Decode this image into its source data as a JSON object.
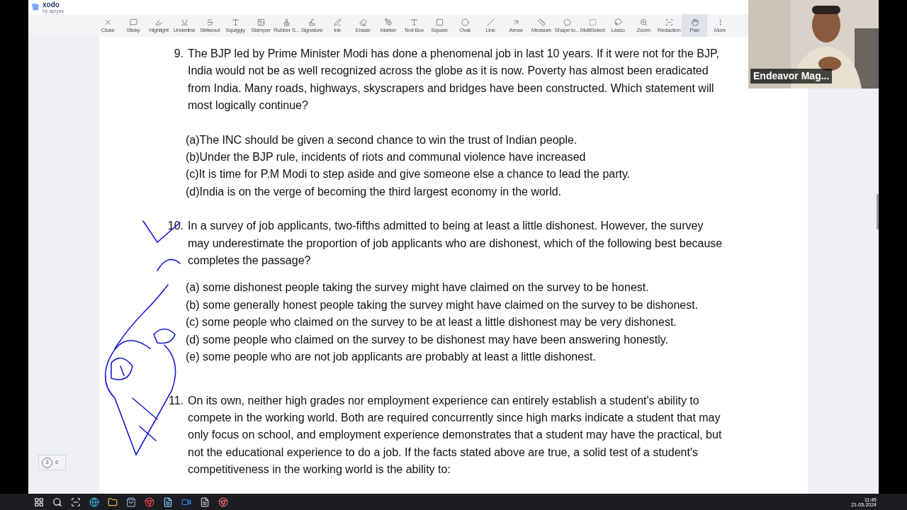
{
  "app": {
    "logo": "xodo",
    "logo_sub": "by apryse"
  },
  "toolbar": [
    {
      "label": "Close",
      "selected": false
    },
    {
      "label": "Sticky",
      "selected": false
    },
    {
      "label": "Highlight",
      "selected": false
    },
    {
      "label": "Underline",
      "selected": false
    },
    {
      "label": "Strikeout",
      "selected": false
    },
    {
      "label": "Squiggly",
      "selected": false
    },
    {
      "label": "Stamper",
      "selected": false
    },
    {
      "label": "Rubber S...",
      "selected": false
    },
    {
      "label": "Signature",
      "selected": false
    },
    {
      "label": "Ink",
      "selected": false
    },
    {
      "label": "Eraser",
      "selected": false
    },
    {
      "label": "Marker",
      "selected": false
    },
    {
      "label": "Text Box",
      "selected": false
    },
    {
      "label": "Square",
      "selected": false
    },
    {
      "label": "Oval",
      "selected": false
    },
    {
      "label": "Line",
      "selected": false
    },
    {
      "label": "Arrow",
      "selected": false
    },
    {
      "label": "Measure",
      "selected": false
    },
    {
      "label": "Shape to...",
      "selected": false
    },
    {
      "label": "MultiSelect",
      "selected": false
    },
    {
      "label": "Lasso",
      "selected": false
    },
    {
      "label": "Zoom",
      "selected": false
    },
    {
      "label": "Redaction",
      "selected": false
    },
    {
      "label": "Pan",
      "selected": true
    },
    {
      "label": "More",
      "selected": false
    }
  ],
  "questions": [
    {
      "number": "9.",
      "lines": [
        "The BJP led by Prime Minister Modi has done a phenomenal job in last 10 years. If it were not for the BJP,",
        "India would not be as well recognized across the globe as it is now. Poverty has almost been eradicated",
        "from India. Many roads, highways, skyscrapers and bridges have been constructed. Which statement will",
        "most logically continue?"
      ],
      "options": [
        "(a)The INC should be given a second chance to win the trust of Indian people.",
        "(b)Under the BJP rule, incidents of riots and communal violence have increased",
        "(c)It is time for P.M Modi to step aside and give someone else a chance to lead the party.",
        "(d)India is on the verge of becoming the third largest economy in the world."
      ]
    },
    {
      "number": "10.",
      "lines": [
        "In a survey of job applicants, two-fifths admitted to being at least a little dishonest. However, the survey",
        "may underestimate the proportion of job applicants who are dishonest, which of the following best because",
        "completes the passage?"
      ],
      "options": [
        "(a) some dishonest people taking the survey might have claimed on the survey to be honest.",
        "(b) some generally honest people taking the survey might have claimed on the survey to be dishonest.",
        "(c) some people who claimed on the survey to be at least a little dishonest may be very dishonest.",
        "(d) some people who claimed on the survey to be dishonest may have been answering honestly.",
        "(e) some people who are not job applicants are probably at least a little dishonest."
      ]
    },
    {
      "number": "11.",
      "lines": [
        "On its own, neither high grades nor employment experience can entirely establish a student's ability to",
        "compete in the working world. Both are required concurrently since high marks indicate a student that may",
        "only focus on school, and employment experience demonstrates that a student may have the practical, but",
        "not the educational experience to do a job. If the facts stated above are true, a solid test of a student's",
        "competitiveness in the working world is the ability to:"
      ]
    }
  ],
  "page_indicator": {
    "current": "3",
    "total": "6"
  },
  "video": {
    "name": "Endeavor Mag..."
  },
  "taskbar": {
    "time": "11:45",
    "date": "21-05-2024"
  }
}
